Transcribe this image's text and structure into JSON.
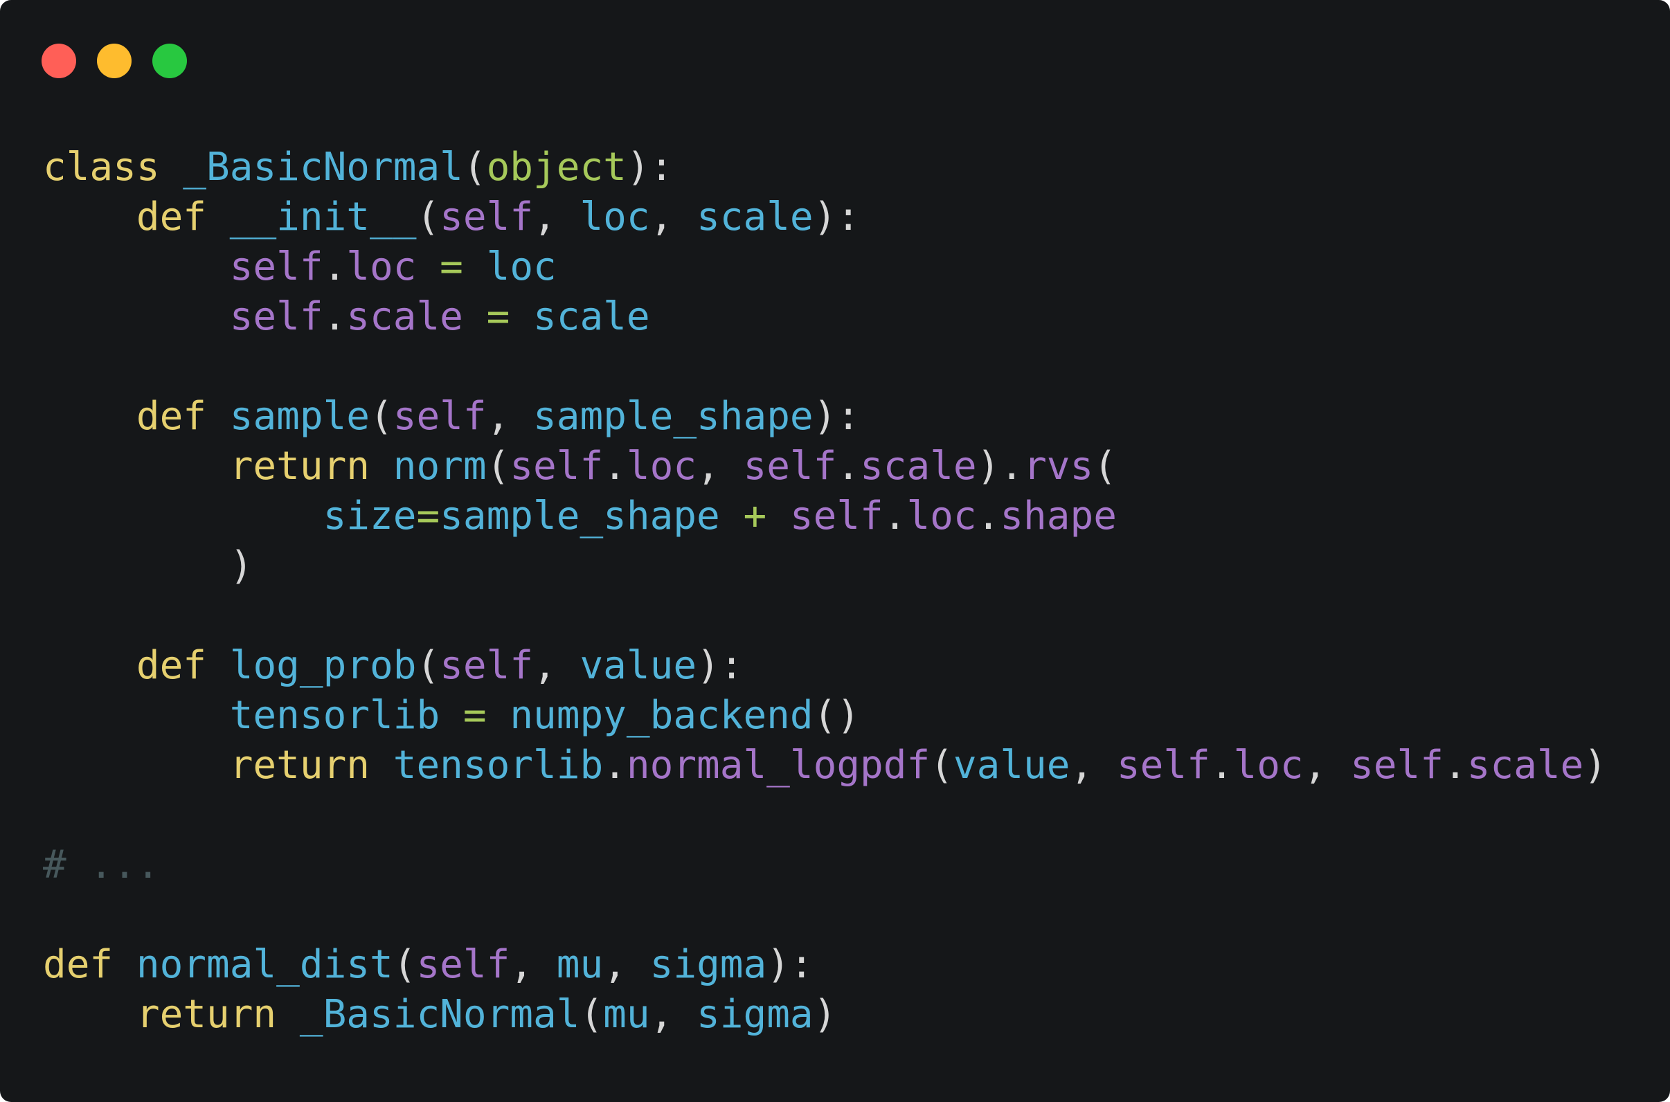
{
  "window": {
    "background": "#151719",
    "controls": [
      {
        "name": "close",
        "color": "#ff5f57"
      },
      {
        "name": "minimize",
        "color": "#febc2e"
      },
      {
        "name": "maximize",
        "color": "#28c840"
      }
    ]
  },
  "palette": {
    "kw": "#e6d06f",
    "fn": "#52b3d9",
    "builtin": "#a6c95a",
    "self": "#a575c9",
    "op": "#a6c95a",
    "punct": "#d6d6d6",
    "comment": "#47585c"
  },
  "code": {
    "lines": [
      [
        [
          "kw",
          "class"
        ],
        [
          "punct",
          " "
        ],
        [
          "fn",
          "_BasicNormal"
        ],
        [
          "punct",
          "("
        ],
        [
          "builtin",
          "object"
        ],
        [
          "punct",
          "):"
        ]
      ],
      [
        [
          "punct",
          "    "
        ],
        [
          "kw",
          "def"
        ],
        [
          "punct",
          " "
        ],
        [
          "fn",
          "__init__"
        ],
        [
          "punct",
          "("
        ],
        [
          "self",
          "self"
        ],
        [
          "punct",
          ", "
        ],
        [
          "fn",
          "loc"
        ],
        [
          "punct",
          ", "
        ],
        [
          "fn",
          "scale"
        ],
        [
          "punct",
          "):"
        ]
      ],
      [
        [
          "punct",
          "        "
        ],
        [
          "self",
          "self"
        ],
        [
          "punct",
          "."
        ],
        [
          "self",
          "loc"
        ],
        [
          "punct",
          " "
        ],
        [
          "op",
          "="
        ],
        [
          "punct",
          " "
        ],
        [
          "fn",
          "loc"
        ]
      ],
      [
        [
          "punct",
          "        "
        ],
        [
          "self",
          "self"
        ],
        [
          "punct",
          "."
        ],
        [
          "self",
          "scale"
        ],
        [
          "punct",
          " "
        ],
        [
          "op",
          "="
        ],
        [
          "punct",
          " "
        ],
        [
          "fn",
          "scale"
        ]
      ],
      [],
      [
        [
          "punct",
          "    "
        ],
        [
          "kw",
          "def"
        ],
        [
          "punct",
          " "
        ],
        [
          "fn",
          "sample"
        ],
        [
          "punct",
          "("
        ],
        [
          "self",
          "self"
        ],
        [
          "punct",
          ", "
        ],
        [
          "fn",
          "sample_shape"
        ],
        [
          "punct",
          "):"
        ]
      ],
      [
        [
          "punct",
          "        "
        ],
        [
          "kw",
          "return"
        ],
        [
          "punct",
          " "
        ],
        [
          "fn",
          "norm"
        ],
        [
          "punct",
          "("
        ],
        [
          "self",
          "self"
        ],
        [
          "punct",
          "."
        ],
        [
          "self",
          "loc"
        ],
        [
          "punct",
          ", "
        ],
        [
          "self",
          "self"
        ],
        [
          "punct",
          "."
        ],
        [
          "self",
          "scale"
        ],
        [
          "punct",
          ")."
        ],
        [
          "self",
          "rvs"
        ],
        [
          "punct",
          "("
        ]
      ],
      [
        [
          "punct",
          "            "
        ],
        [
          "fn",
          "size"
        ],
        [
          "op",
          "="
        ],
        [
          "fn",
          "sample_shape"
        ],
        [
          "punct",
          " "
        ],
        [
          "op",
          "+"
        ],
        [
          "punct",
          " "
        ],
        [
          "self",
          "self"
        ],
        [
          "punct",
          "."
        ],
        [
          "self",
          "loc"
        ],
        [
          "punct",
          "."
        ],
        [
          "self",
          "shape"
        ]
      ],
      [
        [
          "punct",
          "        )"
        ]
      ],
      [],
      [
        [
          "punct",
          "    "
        ],
        [
          "kw",
          "def"
        ],
        [
          "punct",
          " "
        ],
        [
          "fn",
          "log_prob"
        ],
        [
          "punct",
          "("
        ],
        [
          "self",
          "self"
        ],
        [
          "punct",
          ", "
        ],
        [
          "fn",
          "value"
        ],
        [
          "punct",
          "):"
        ]
      ],
      [
        [
          "punct",
          "        "
        ],
        [
          "fn",
          "tensorlib"
        ],
        [
          "punct",
          " "
        ],
        [
          "op",
          "="
        ],
        [
          "punct",
          " "
        ],
        [
          "fn",
          "numpy_backend"
        ],
        [
          "punct",
          "()"
        ]
      ],
      [
        [
          "punct",
          "        "
        ],
        [
          "kw",
          "return"
        ],
        [
          "punct",
          " "
        ],
        [
          "fn",
          "tensorlib"
        ],
        [
          "punct",
          "."
        ],
        [
          "self",
          "normal_logpdf"
        ],
        [
          "punct",
          "("
        ],
        [
          "fn",
          "value"
        ],
        [
          "punct",
          ", "
        ],
        [
          "self",
          "self"
        ],
        [
          "punct",
          "."
        ],
        [
          "self",
          "loc"
        ],
        [
          "punct",
          ", "
        ],
        [
          "self",
          "self"
        ],
        [
          "punct",
          "."
        ],
        [
          "self",
          "scale"
        ],
        [
          "punct",
          ")"
        ]
      ],
      [],
      [
        [
          "comment",
          "# ..."
        ]
      ],
      [],
      [
        [
          "kw",
          "def"
        ],
        [
          "punct",
          " "
        ],
        [
          "fn",
          "normal_dist"
        ],
        [
          "punct",
          "("
        ],
        [
          "self",
          "self"
        ],
        [
          "punct",
          ", "
        ],
        [
          "fn",
          "mu"
        ],
        [
          "punct",
          ", "
        ],
        [
          "fn",
          "sigma"
        ],
        [
          "punct",
          "):"
        ]
      ],
      [
        [
          "punct",
          "    "
        ],
        [
          "kw",
          "return"
        ],
        [
          "punct",
          " "
        ],
        [
          "fn",
          "_BasicNormal"
        ],
        [
          "punct",
          "("
        ],
        [
          "fn",
          "mu"
        ],
        [
          "punct",
          ", "
        ],
        [
          "fn",
          "sigma"
        ],
        [
          "punct",
          ")"
        ]
      ]
    ]
  }
}
